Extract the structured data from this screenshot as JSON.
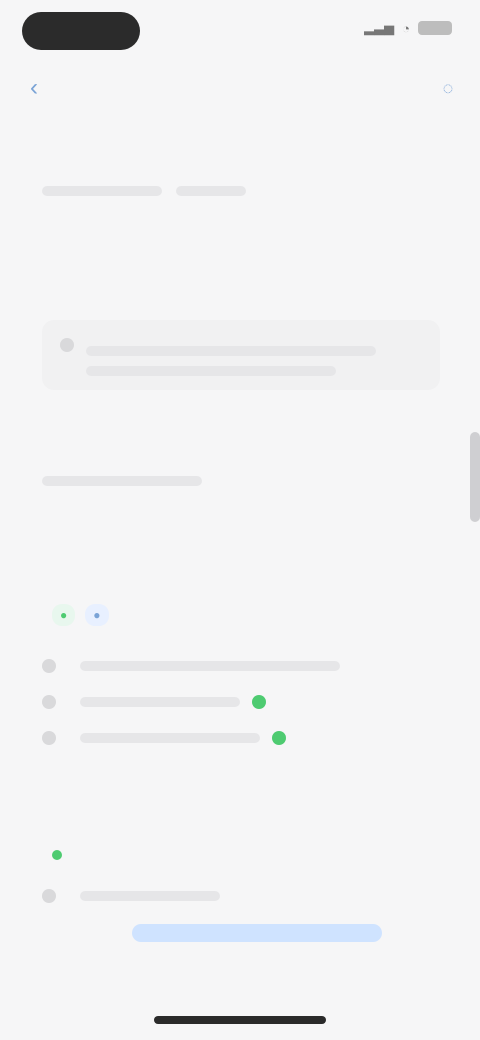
{
  "status": {
    "time": "",
    "icons": [
      "signal-icon",
      "wifi-icon",
      "battery-icon"
    ]
  },
  "nav": {
    "title": "",
    "back_label": "",
    "action_label": ""
  },
  "sections": {
    "top": {
      "title": "",
      "subtitle_left": "",
      "subtitle_right": "",
      "meta": ""
    },
    "notice": {
      "text_line_1": "",
      "text_line_2": ""
    },
    "group2": {
      "title": "",
      "subtitle": ""
    },
    "group3": {
      "line1": "",
      "line2": "",
      "row1": "",
      "row2": "",
      "row3": ""
    },
    "group4": {
      "title": "",
      "subtitle": "",
      "row": "",
      "link": ""
    }
  },
  "colors": {
    "accent": "#7aa3d6",
    "green": "#4ecb71",
    "background": "#f6f6f7"
  }
}
